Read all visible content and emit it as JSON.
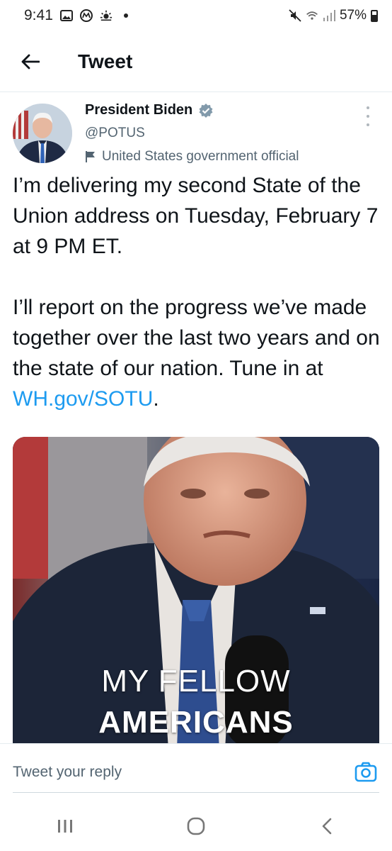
{
  "status_bar": {
    "time": "9:41",
    "battery": "57%",
    "icons": [
      "gallery-icon",
      "app-icon",
      "weather-icon",
      "dot-icon",
      "mute-icon",
      "wifi-icon",
      "signal-icon",
      "battery-icon"
    ]
  },
  "header": {
    "title": "Tweet",
    "back_icon": "arrow-left-icon"
  },
  "tweet": {
    "author_name": "President Biden",
    "verified_icon": "verified-badge-icon",
    "handle": "@POTUS",
    "label": "United States government official",
    "label_icon": "flag-icon",
    "more_icon": "more-vertical-icon",
    "paragraph_1": "I’m delivering my second State of the Union address on Tuesday, February 7 at 9 PM ET.",
    "paragraph_2_text": "I’ll report on the progress we’ve made together over the last two years and on the state of our nation. Tune in at ",
    "paragraph_2_link": "WH.gov/SOTU",
    "paragraph_2_end": ".",
    "media": {
      "caption_line_1": "MY FELLOW",
      "caption_line_2": "AMERICANS"
    }
  },
  "reply": {
    "placeholder": "Tweet your reply",
    "camera_icon": "camera-icon"
  },
  "nav": {
    "icons": [
      "recent-apps-icon",
      "home-icon",
      "back-icon"
    ]
  },
  "colors": {
    "link": "#1d9bf0",
    "verified": "#829aab",
    "text": "#0f1419",
    "secondary": "#536471"
  }
}
